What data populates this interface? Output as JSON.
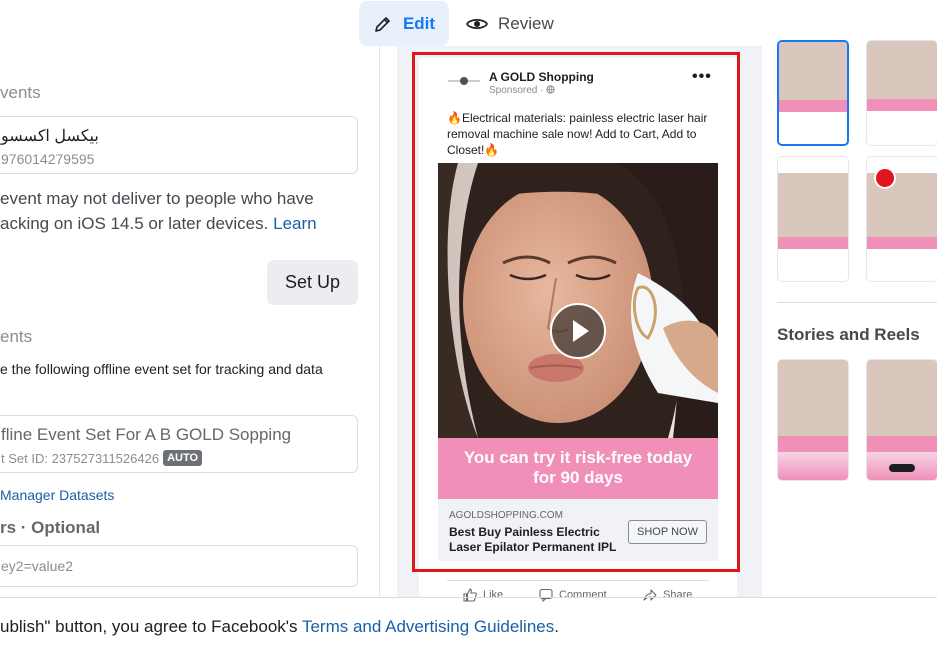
{
  "mode_tabs": {
    "edit": "Edit",
    "review": "Review"
  },
  "left_panel": {
    "website_events_label": "vents",
    "pixel_name": "بيكسل اكسسو",
    "pixel_id": "976014279595",
    "warning_line1": "event may not deliver to people who have",
    "warning_line2": "acking on iOS 14.5 or later devices.",
    "learn_link": "Learn",
    "setup_button": "Set Up",
    "offline_events_label": "ents",
    "offline_desc": "e the following offline event set for tracking and data",
    "offline_set_name": "fline Event Set For A B GOLD Sopping",
    "offline_set_id": "t Set ID: 237527311526426",
    "auto_badge": "AUTO",
    "manager_link": "Manager Datasets",
    "params_label": "rs · Optional",
    "params_placeholder": "ey2=value2"
  },
  "ad_preview": {
    "page_name": "A GOLD Shopping",
    "sponsored": "Sponsored ·",
    "caption": "🔥Electrical materials: painless electric laser hair removal machine sale now! Add to Cart, Add to Closet!🔥",
    "banner_line1": "You can try it risk-free today",
    "banner_line2": "for 90 days",
    "domain": "AGOLDSHOPPING.COM",
    "headline": "Best Buy Painless Electric Laser Epilator Permanent IPL",
    "cta": "SHOP NOW",
    "like": "Like",
    "comment": "Comment",
    "share": "Share"
  },
  "placements": {
    "stories_title": "Stories and Reels"
  },
  "footer": {
    "prefix": "ublish\" button, you agree to Facebook's",
    "link": "Terms and Advertising Guidelines",
    "suffix": "."
  },
  "colors": {
    "accent": "#1877f2",
    "highlight_frame": "#e0161d",
    "banner_pink": "#f08fb8"
  }
}
